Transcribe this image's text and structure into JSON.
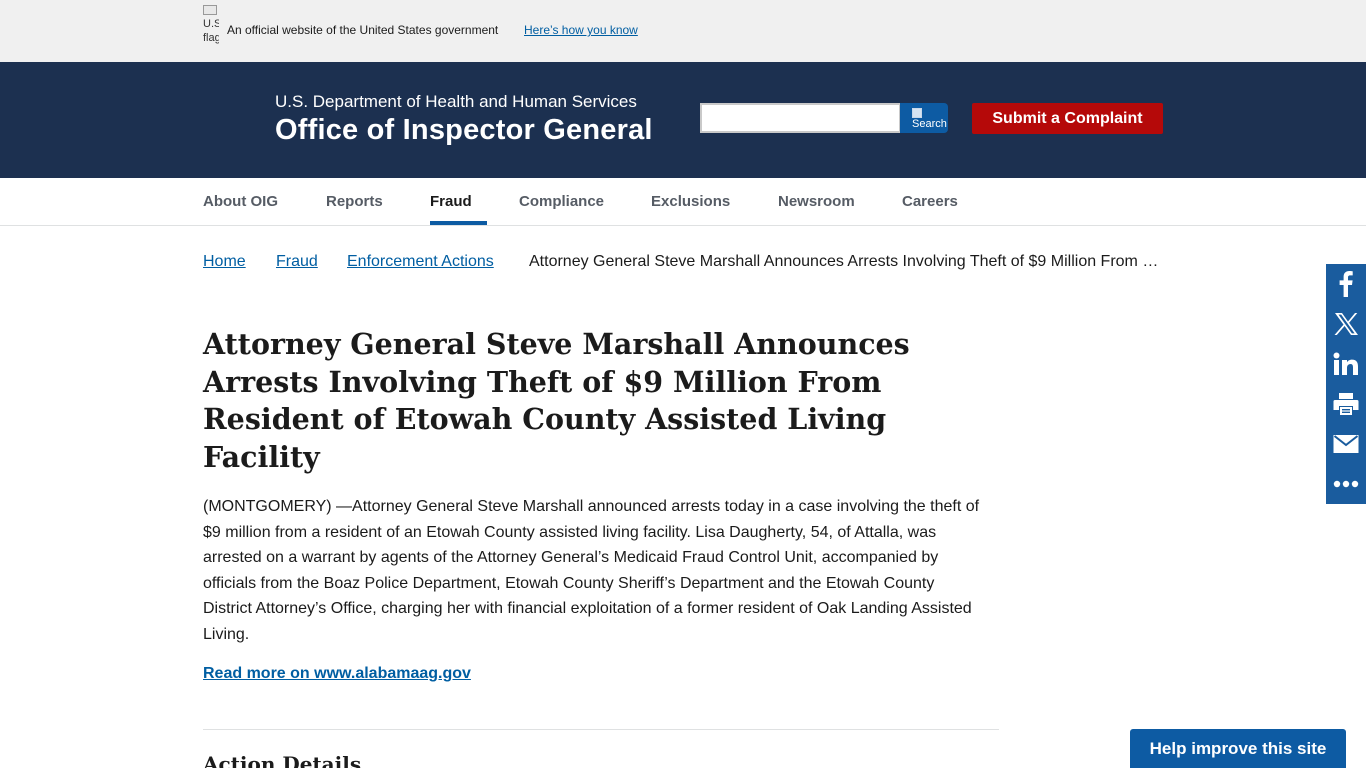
{
  "gov_banner": {
    "flag_alt": "U.S. flag",
    "text": "An official website of the United States government",
    "link": "Here’s how you know"
  },
  "header": {
    "department": "U.S. Department of Health and Human Services",
    "title": "Office of Inspector General",
    "search": {
      "value": "",
      "placeholder": "",
      "button_alt": "Search"
    },
    "complaint_button": "Submit a Complaint"
  },
  "nav": {
    "items": [
      "About OIG",
      "Reports",
      "Fraud",
      "Compliance",
      "Exclusions",
      "Newsroom",
      "Careers"
    ],
    "active": "Fraud"
  },
  "breadcrumb": {
    "links": [
      "Home",
      "Fraud",
      "Enforcement Actions"
    ],
    "current": "Attorney General Steve Marshall Announces Arrests Involving Theft of $9 Million From Resident of Etowah County Assisted Living Facility"
  },
  "article": {
    "title": "Attorney General Steve Marshall Announces Arrests Involving Theft of $9 Million From Resident of Etowah County Assisted Living Facility",
    "body": "(MONTGOMERY) —Attorney General Steve Marshall announced arrests today in a case involving the theft of $9 million from a resident of an Etowah County assisted living facility. Lisa Daugherty, 54, of Attalla, was arrested on a warrant by agents of the Attorney General’s Medicaid Fraud Control Unit, accompanied by officials from the Boaz Police Department, Etowah County Sheriff’s Department and the Etowah County District Attorney’s Office, charging her with financial exploitation of a former resident of Oak Landing Assisted Living.",
    "read_more": "Read more on www.alabamaag.gov",
    "section_heading": "Action Details"
  },
  "share": {
    "icons": [
      "facebook-icon",
      "x-icon",
      "linkedin-icon",
      "print-icon",
      "email-icon",
      "more-icon"
    ]
  },
  "help_button": "Help improve this site",
  "colors": {
    "header_bg": "#1c3050",
    "complaint_red": "#b50909",
    "link_blue": "#005ea2",
    "accent_blue": "#0d5ba3",
    "share_bg": "#1a5c9e"
  }
}
